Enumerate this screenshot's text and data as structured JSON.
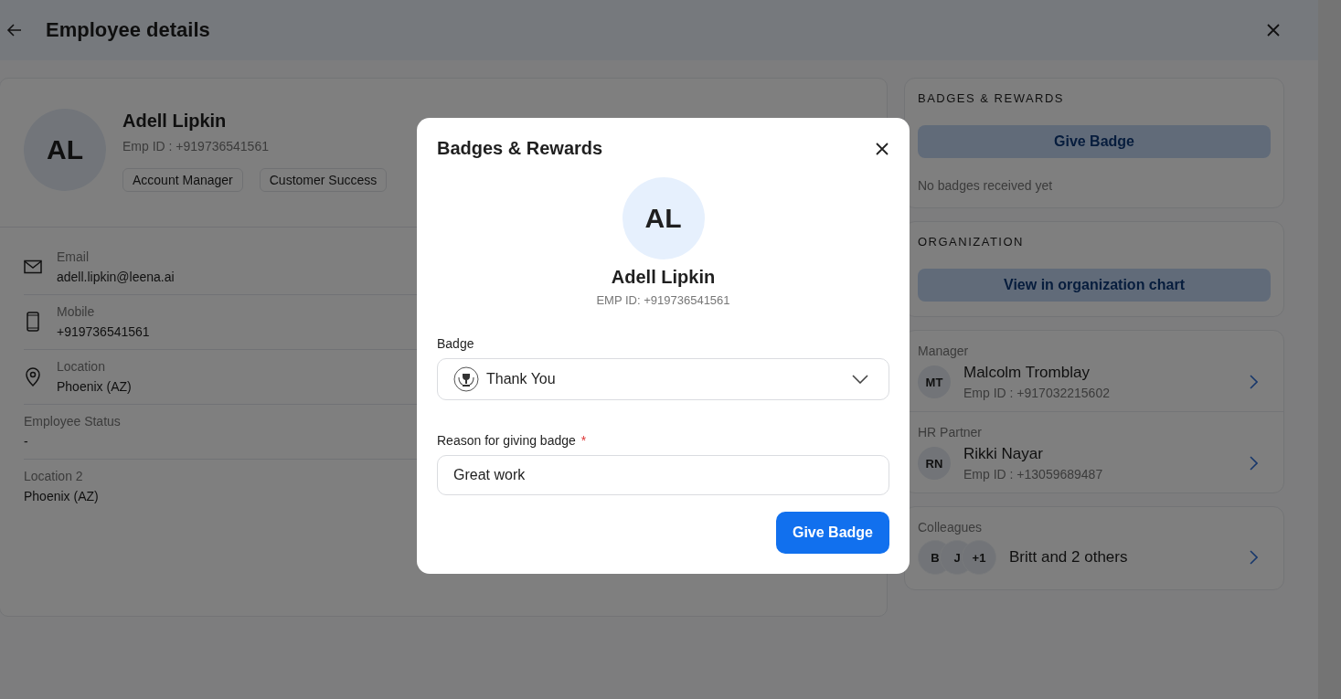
{
  "header": {
    "title": "Employee details"
  },
  "profile": {
    "initials": "AL",
    "name": "Adell Lipkin",
    "emp_id": "Emp ID : +919736541561",
    "tags": [
      "Account Manager",
      "Customer Success"
    ]
  },
  "details": [
    {
      "kind": "email",
      "label": "Email",
      "value": "adell.lipkin@leena.ai"
    },
    {
      "kind": "mobile",
      "label": "Mobile",
      "value": "+919736541561"
    },
    {
      "kind": "location",
      "label": "Location",
      "value": "Phoenix (AZ)"
    },
    {
      "kind": "plain",
      "label": "Employee Status",
      "value": "-"
    },
    {
      "kind": "plain",
      "label": "Location 2",
      "value": "Phoenix (AZ)"
    }
  ],
  "badges_panel": {
    "heading": "BADGES & REWARDS",
    "button": "Give Badge",
    "empty_text": "No badges received yet"
  },
  "organization_panel": {
    "heading": "ORGANIZATION",
    "button": "View in organization chart"
  },
  "people": [
    {
      "role": "Manager",
      "initials": "MT",
      "name": "Malcolm Tromblay",
      "emp_id": "Emp ID : +917032215602"
    },
    {
      "role": "HR Partner",
      "initials": "RN",
      "name": "Rikki Nayar",
      "emp_id": "Emp ID : +13059689487"
    }
  ],
  "colleagues": {
    "label": "Colleagues",
    "avatars": [
      "B",
      "J",
      "+1"
    ],
    "summary": "Britt and 2 others"
  },
  "modal": {
    "title": "Badges & Rewards",
    "initials": "AL",
    "name": "Adell Lipkin",
    "emp_id": "EMP ID: +919736541561",
    "badge_label": "Badge",
    "badge_value": "Thank You",
    "reason_label": "Reason for giving badge",
    "required_mark": "*",
    "reason_value": "Great work",
    "submit": "Give Badge"
  }
}
